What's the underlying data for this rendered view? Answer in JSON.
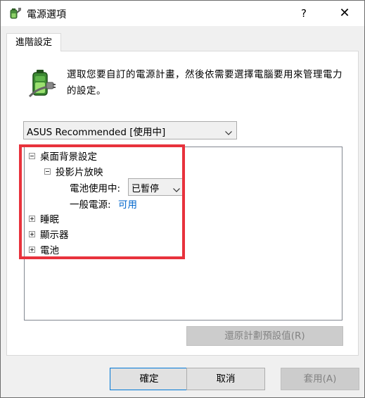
{
  "window": {
    "title": "電源選項",
    "help_label": "?",
    "close_label": "✕"
  },
  "tabs": [
    {
      "label": "進階設定",
      "selected": true
    }
  ],
  "description": "選取您要自訂的電源計畫，然後依需要選擇電腦要用來管理電力的設定。",
  "plan_select": {
    "value": "ASUS Recommended [使用中]"
  },
  "tree": {
    "items": [
      {
        "label": "桌面背景設定",
        "expanded": true,
        "children": [
          {
            "label": "投影片放映",
            "expanded": true,
            "settings": [
              {
                "label": "電池使用中:",
                "value": "已暫停",
                "control": "select"
              },
              {
                "label": "一般電源:",
                "value": "可用",
                "control": "link"
              }
            ]
          }
        ]
      },
      {
        "label": "睡眠",
        "expanded": false
      },
      {
        "label": "顯示器",
        "expanded": false
      },
      {
        "label": "電池",
        "expanded": false
      }
    ]
  },
  "buttons": {
    "restore_defaults": "還原計劃預設值(R)",
    "ok": "確定",
    "cancel": "取消",
    "apply": "套用(A)"
  },
  "icons": {
    "title": "power-plug-battery-icon",
    "main": "battery-plug-icon",
    "expander": "expander-icon",
    "dropdown": "chevron-down-icon"
  },
  "colors": {
    "highlight": "#e8323c",
    "link": "#0066cc",
    "accent_border": "#0078d7"
  }
}
